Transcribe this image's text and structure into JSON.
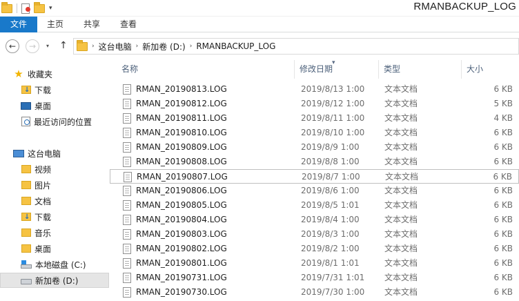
{
  "window": {
    "title": "RMANBACKUP_LOG",
    "qat_dropdown_glyph": "▾"
  },
  "ribbon": {
    "tabs": [
      {
        "label": "文件",
        "active": true
      },
      {
        "label": "主页"
      },
      {
        "label": "共享"
      },
      {
        "label": "查看"
      }
    ],
    "accent": "#1979ca"
  },
  "nav": {
    "back_glyph": "←",
    "forward_glyph": "→",
    "recent_glyph": "▾",
    "up_glyph": "↑",
    "crumb_separator": "›",
    "breadcrumb": [
      "这台电脑",
      "新加卷 (D:)",
      "RMANBACKUP_LOG"
    ]
  },
  "sidebar": {
    "favorites": {
      "label": "收藏夹",
      "items": [
        {
          "label": "下载",
          "icon": "download-folder-icon"
        },
        {
          "label": "桌面",
          "icon": "desktop-icon"
        },
        {
          "label": "最近访问的位置",
          "icon": "recent-places-icon"
        }
      ]
    },
    "this_pc": {
      "label": "这台电脑",
      "items": [
        {
          "label": "视频",
          "icon": "videos-folder-icon"
        },
        {
          "label": "图片",
          "icon": "pictures-folder-icon"
        },
        {
          "label": "文档",
          "icon": "documents-folder-icon"
        },
        {
          "label": "下载",
          "icon": "download-folder-icon"
        },
        {
          "label": "音乐",
          "icon": "music-folder-icon"
        },
        {
          "label": "桌面",
          "icon": "desktop-folder-icon"
        },
        {
          "label": "本地磁盘 (C:)",
          "icon": "system-drive-icon"
        },
        {
          "label": "新加卷 (D:)",
          "icon": "drive-icon",
          "selected": true
        }
      ]
    }
  },
  "filelist": {
    "columns": {
      "name": "名称",
      "date": "修改日期",
      "type": "类型",
      "size": "大小",
      "sort_glyph": "▾"
    },
    "rows": [
      {
        "name": "RMAN_20190813.LOG",
        "date": "2019/8/13 1:00",
        "type": "文本文档",
        "size": "6 KB"
      },
      {
        "name": "RMAN_20190812.LOG",
        "date": "2019/8/12 1:00",
        "type": "文本文档",
        "size": "5 KB"
      },
      {
        "name": "RMAN_20190811.LOG",
        "date": "2019/8/11 1:00",
        "type": "文本文档",
        "size": "4 KB"
      },
      {
        "name": "RMAN_20190810.LOG",
        "date": "2019/8/10 1:00",
        "type": "文本文档",
        "size": "6 KB"
      },
      {
        "name": "RMAN_20190809.LOG",
        "date": "2019/8/9 1:00",
        "type": "文本文档",
        "size": "6 KB"
      },
      {
        "name": "RMAN_20190808.LOG",
        "date": "2019/8/8 1:00",
        "type": "文本文档",
        "size": "6 KB"
      },
      {
        "name": "RMAN_20190807.LOG",
        "date": "2019/8/7 1:00",
        "type": "文本文档",
        "size": "6 KB",
        "focused": true
      },
      {
        "name": "RMAN_20190806.LOG",
        "date": "2019/8/6 1:00",
        "type": "文本文档",
        "size": "6 KB"
      },
      {
        "name": "RMAN_20190805.LOG",
        "date": "2019/8/5 1:01",
        "type": "文本文档",
        "size": "6 KB"
      },
      {
        "name": "RMAN_20190804.LOG",
        "date": "2019/8/4 1:00",
        "type": "文本文档",
        "size": "6 KB"
      },
      {
        "name": "RMAN_20190803.LOG",
        "date": "2019/8/3 1:00",
        "type": "文本文档",
        "size": "6 KB"
      },
      {
        "name": "RMAN_20190802.LOG",
        "date": "2019/8/2 1:00",
        "type": "文本文档",
        "size": "6 KB"
      },
      {
        "name": "RMAN_20190801.LOG",
        "date": "2019/8/1 1:01",
        "type": "文本文档",
        "size": "6 KB"
      },
      {
        "name": "RMAN_20190731.LOG",
        "date": "2019/7/31 1:01",
        "type": "文本文档",
        "size": "6 KB"
      },
      {
        "name": "RMAN_20190730.LOG",
        "date": "2019/7/30 1:00",
        "type": "文本文档",
        "size": "6 KB"
      }
    ]
  }
}
